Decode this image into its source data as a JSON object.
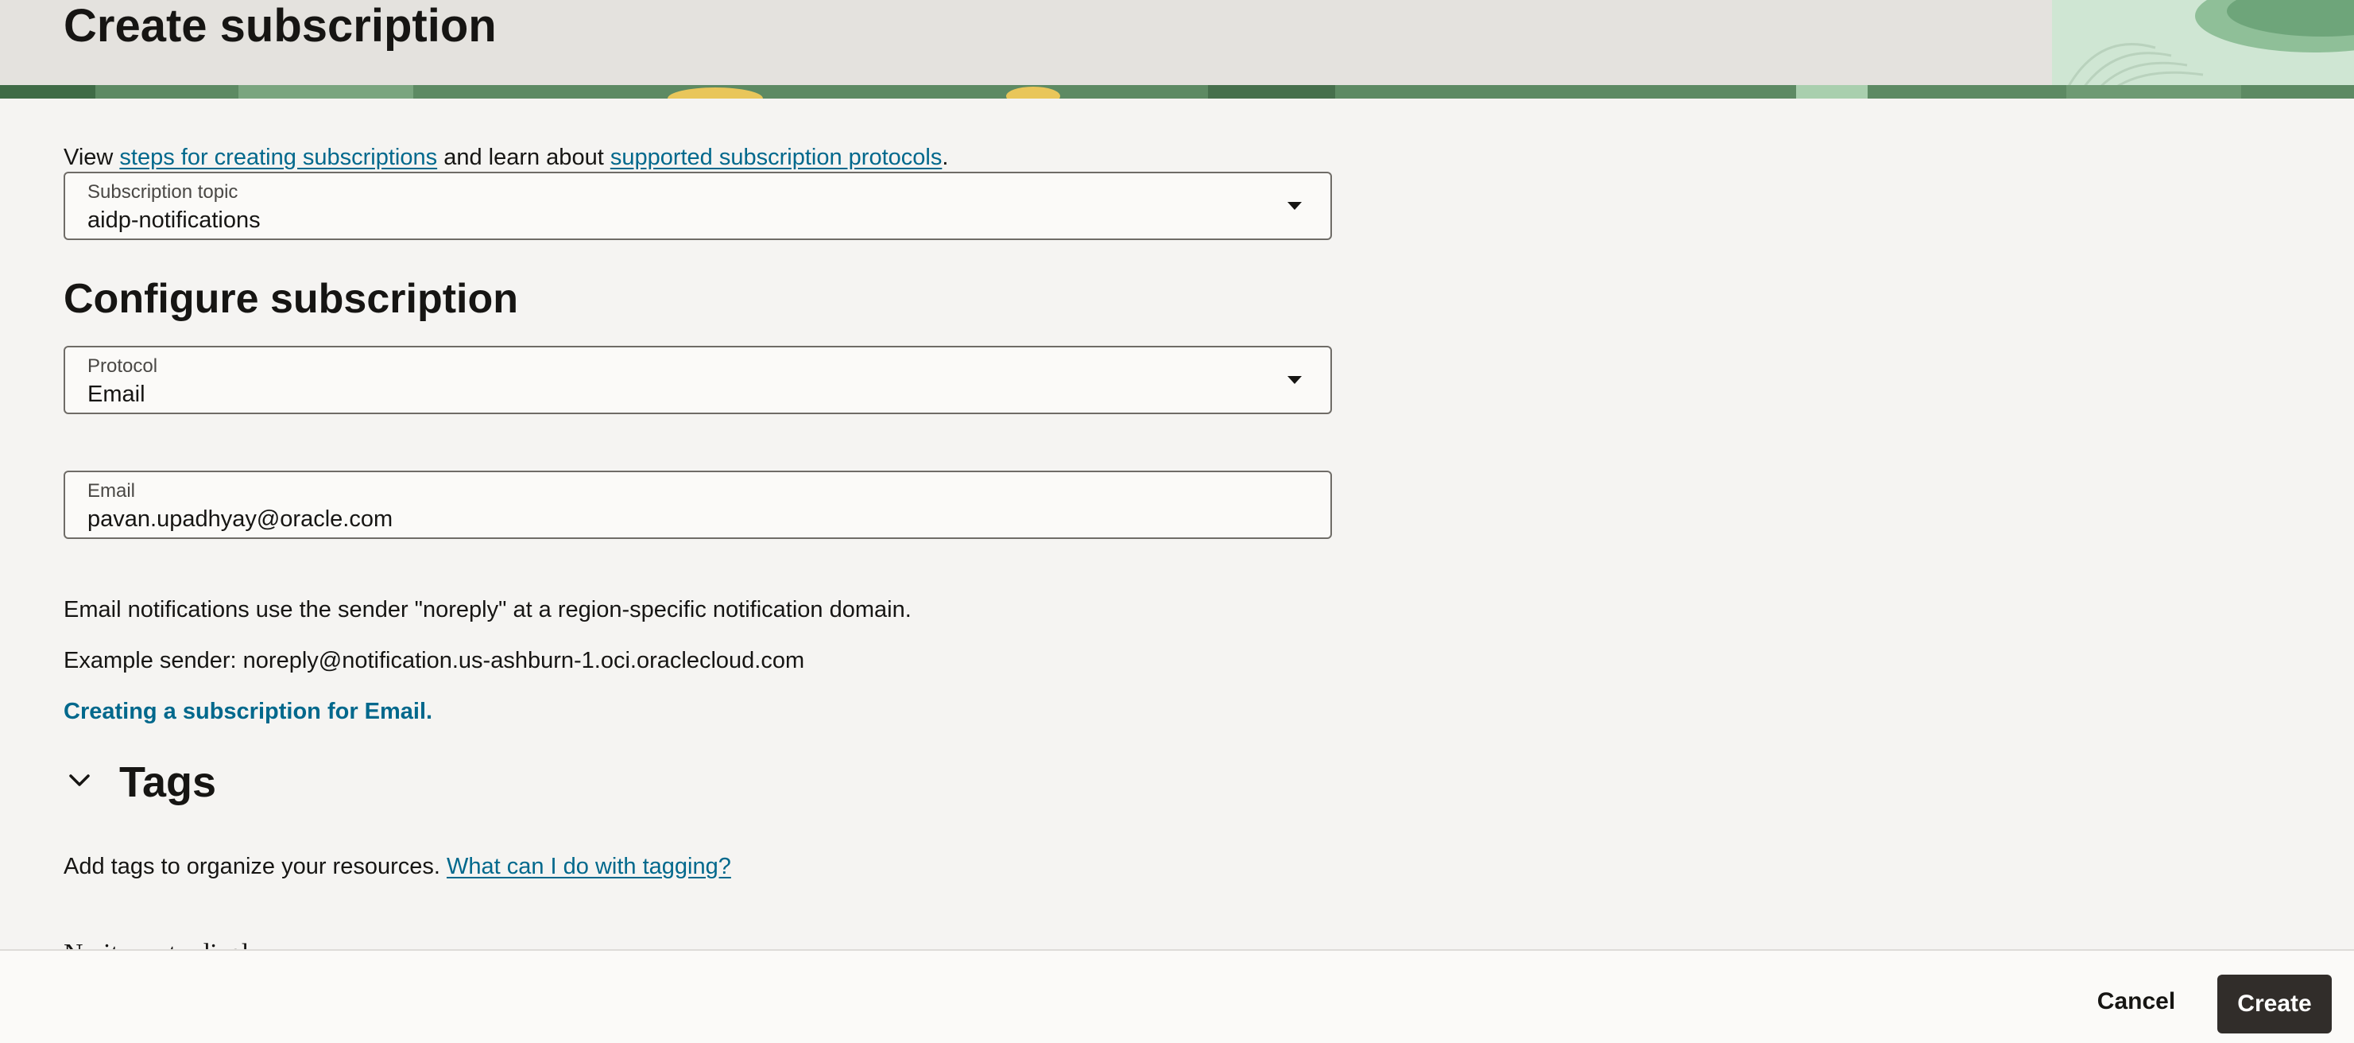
{
  "header": {
    "title": "Create subscription"
  },
  "intro": {
    "prefix": "View ",
    "link1": "steps for creating subscriptions",
    "middle": " and learn about ",
    "link2": "supported subscription protocols",
    "suffix": "."
  },
  "subscription_topic": {
    "label": "Subscription topic",
    "value": "aidp-notifications"
  },
  "configure": {
    "heading": "Configure subscription",
    "protocol": {
      "label": "Protocol",
      "value": "Email"
    },
    "email": {
      "label": "Email",
      "value": "pavan.upadhyay@oracle.com"
    },
    "note1": "Email notifications use the sender \"noreply\" at a region-specific notification domain.",
    "note2": "Example sender: noreply@notification.us-ashburn-1.oci.oraclecloud.com",
    "help_link": "Creating a subscription for Email."
  },
  "tags": {
    "heading": "Tags",
    "description": "Add tags to organize your resources. ",
    "help_link": "What can I do with tagging?",
    "partial_text": "No items to display"
  },
  "footer": {
    "cancel_label": "Cancel",
    "create_label": "Create"
  },
  "colors": {
    "link": "#00688c",
    "primary_button": "#312d2a",
    "page_background": "#f5f4f2",
    "header_background": "#e4e2de"
  },
  "icons": {
    "dropdown": "caret-down-icon",
    "collapse": "chevron-down-icon"
  }
}
